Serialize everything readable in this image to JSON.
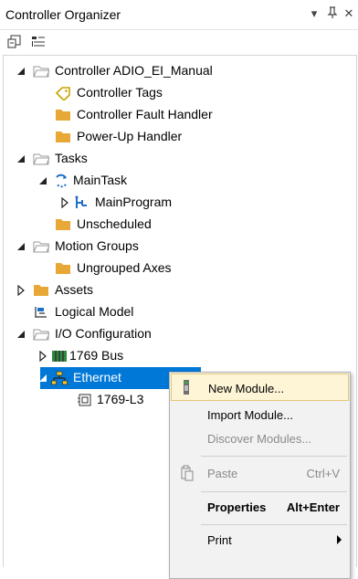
{
  "window": {
    "title": "Controller Organizer"
  },
  "colors": {
    "selection": "#0078d7",
    "folder": "#e8a838",
    "menu_highlight": "#fdf5d6"
  },
  "tree": {
    "controller": "Controller ADIO_EI_Manual",
    "controller_tags": "Controller Tags",
    "fault_handler": "Controller Fault Handler",
    "powerup_handler": "Power-Up Handler",
    "tasks": "Tasks",
    "main_task": "MainTask",
    "main_program": "MainProgram",
    "unscheduled": "Unscheduled",
    "motion_groups": "Motion Groups",
    "ungrouped_axes": "Ungrouped Axes",
    "assets": "Assets",
    "logical_model": "Logical Model",
    "io_config": "I/O Configuration",
    "bus": "1769 Bus",
    "ethernet": "Ethernet",
    "module": "1769-L3"
  },
  "context_menu": {
    "new_module": "New Module...",
    "import_module": "Import Module...",
    "discover_modules": "Discover Modules...",
    "paste": "Paste",
    "paste_shortcut": "Ctrl+V",
    "properties": "Properties",
    "properties_shortcut": "Alt+Enter",
    "print": "Print"
  }
}
